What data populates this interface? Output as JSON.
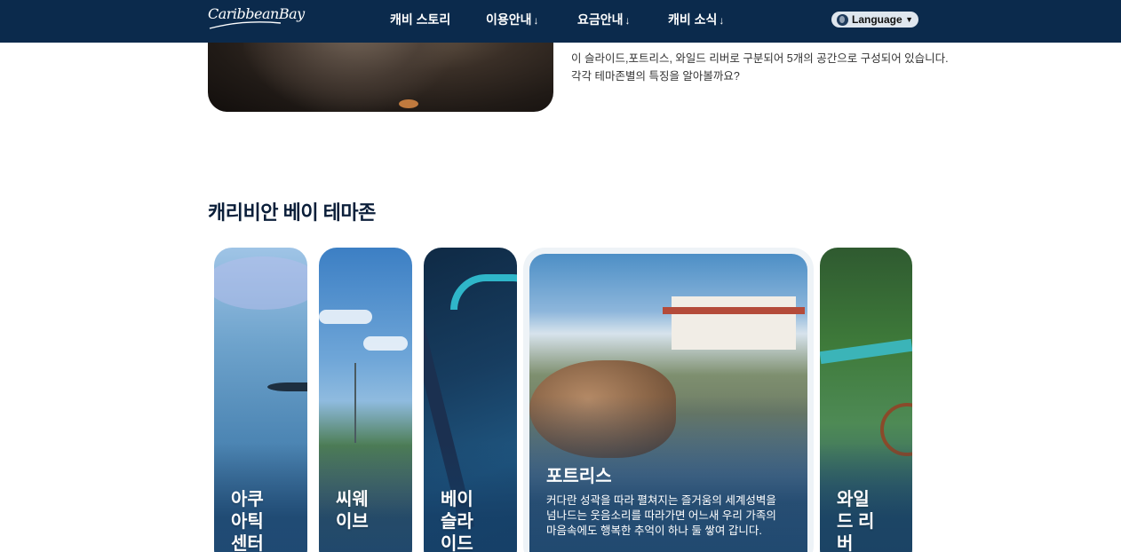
{
  "header": {
    "logo_text": "CaribbeanBay",
    "nav": [
      {
        "label": "캐비 스토리",
        "arrow": ""
      },
      {
        "label": "이용안내",
        "arrow": "↓"
      },
      {
        "label": "요금안내",
        "arrow": "↓"
      },
      {
        "label": "캐비 소식",
        "arrow": "↓"
      }
    ],
    "language": {
      "selected": "Language",
      "icon": "globe-icon"
    }
  },
  "intro": {
    "lines": [
      "이 슬라이드,포트리스, 와일드 리버로 구분되어 5개의 공간으로 구성되어 있습니다.",
      "각각 테마존별의 특징을 알아볼까요?"
    ]
  },
  "themes": {
    "title": "캐리비안 베이 테마존",
    "cards": [
      {
        "label": "아쿠\n아틱\n센터"
      },
      {
        "label": "씨웨\n이브"
      },
      {
        "label": "베이\n슬라\n이드"
      },
      {
        "label": "포트리스",
        "description": "커다란 성곽을 따라 펼쳐지는 즐거움의 세계성벽을 넘나드는 웃음소리를 따라가면 어느새 우리 가족의 마음속에도 행복한 추억이 하나 둘 쌓여 갑니다."
      },
      {
        "label": "와일\n드 리\n버"
      }
    ]
  }
}
